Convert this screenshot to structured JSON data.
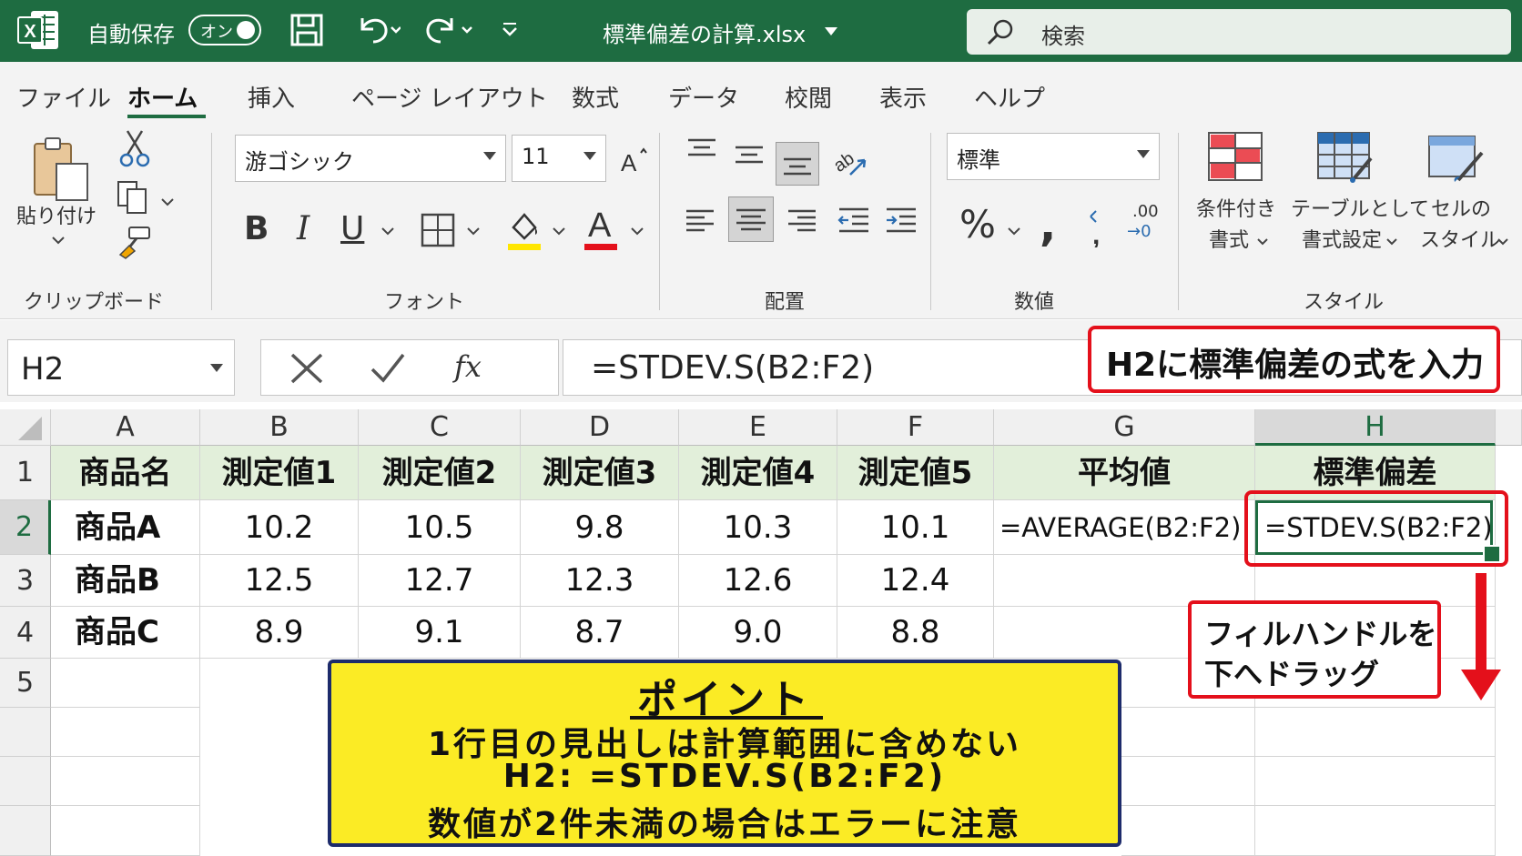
{
  "titlebar": {
    "autosave_label": "自動保存",
    "autosave_state": "オン",
    "filename": "標準偏差の計算.xlsx",
    "search_placeholder": "検索",
    "color": "#1e6c41"
  },
  "tabs": [
    {
      "label": "ファイル"
    },
    {
      "label": "ホーム",
      "active": true
    },
    {
      "label": "挿入"
    },
    {
      "label": "ページ レイアウト"
    },
    {
      "label": "数式"
    },
    {
      "label": "データ"
    },
    {
      "label": "校閲"
    },
    {
      "label": "表示"
    },
    {
      "label": "ヘルプ"
    }
  ],
  "ribbon": {
    "clipboard": {
      "paste_label": "貼り付け",
      "group_label": "クリップボード"
    },
    "font": {
      "name": "游ゴシック",
      "size": "11",
      "group_label": "フォント"
    },
    "alignment": {
      "group_label": "配置"
    },
    "number": {
      "format": "標準",
      "group_label": "数値",
      "decimal_top": ".00",
      "decimal_bottom": "→0"
    },
    "styles": {
      "conditional_line1": "条件付き",
      "conditional_line2": "書式",
      "table_line1": "テーブルとして",
      "table_line2": "書式設定",
      "cell_line1": "セルの",
      "cell_line2": "スタイル",
      "group_label": "スタイル"
    }
  },
  "formula_bar": {
    "name_box": "H2",
    "formula": "=STDEV.S(B2:F2)"
  },
  "callouts": {
    "formula_note": "H2に標準偏差の式を入力",
    "fill_line1": "フィルハンドルを",
    "fill_line2": "下へドラッグ"
  },
  "sheet": {
    "columns": [
      "A",
      "B",
      "C",
      "D",
      "E",
      "F",
      "G",
      "H"
    ],
    "rows": [
      "1",
      "2",
      "3",
      "4",
      "5"
    ],
    "selected_cell": "H2",
    "header_fill": "#e2efda",
    "cells": {
      "A1": "商品名",
      "B1": "測定値1",
      "C1": "測定値2",
      "D1": "測定値3",
      "E1": "測定値4",
      "F1": "測定値5",
      "G1": "平均値",
      "H1": "標準偏差",
      "A2": "商品A",
      "B2": "10.2",
      "C2": "10.5",
      "D2": "9.8",
      "E2": "10.3",
      "F2": "10.1",
      "G2": "=AVERAGE(B2:F2)",
      "H2": "=STDEV.S(B2:F2)",
      "A3": "商品B",
      "B3": "12.5",
      "C3": "12.7",
      "D3": "12.3",
      "E3": "12.6",
      "F3": "12.4",
      "A4": "商品C",
      "B4": "8.9",
      "C4": "9.1",
      "D4": "8.7",
      "E4": "9.0",
      "F4": "8.8"
    }
  },
  "point": {
    "title": "ポイント",
    "line1": "1行目の見出しは計算範囲に含めない",
    "line2": "H2: =STDEV.S(B2:F2)",
    "line3": "数値が2件未満の場合はエラーに注意"
  }
}
